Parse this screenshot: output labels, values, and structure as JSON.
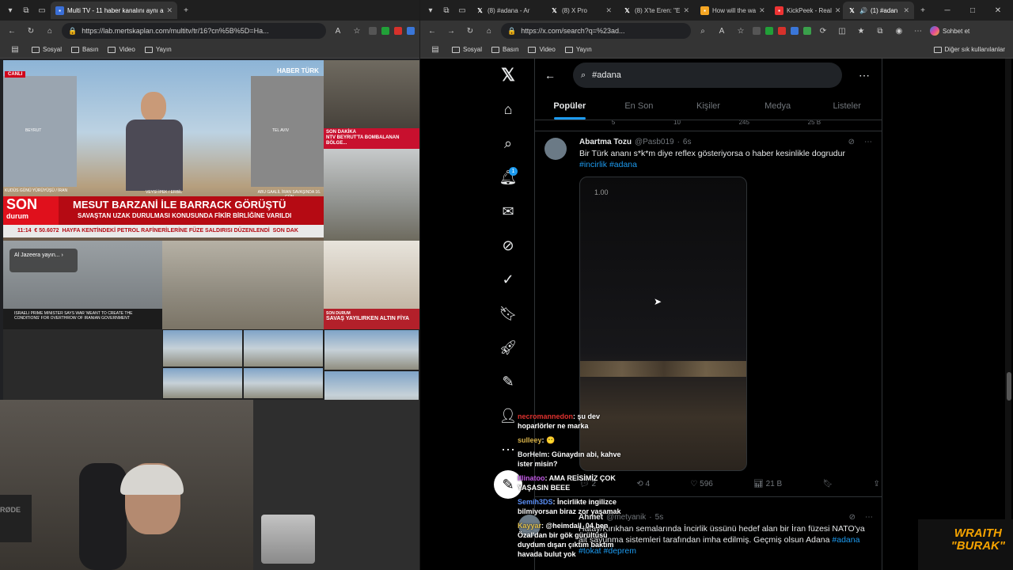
{
  "left_window": {
    "tabs": [
      {
        "title": "Multi TV - 11 haber kanalını aynı a",
        "active": true
      }
    ],
    "url": "https://lab.mertskaplan.com/multitv/tr/16?cn%5B%5D=Ha...",
    "bookmarks": [
      "Sosyal",
      "Basın",
      "Video",
      "Yayın"
    ],
    "multitv": {
      "main_logo": "HABER TÜRK",
      "live_label": "CANLI",
      "captions": {
        "beyrut": "BEYRUT",
        "tel_aviv": "TEL AVIV",
        "kudus": "KUDÜS GÜNÜ YÜRÜYÜŞÜ / İRAN",
        "erbil": "VEYSİ İPEK / ERBİL",
        "abu_gaalil": "ABU GAALİL İRAN SAVAŞINDA 16. GÜN"
      },
      "son_durum": {
        "brand": "SON",
        "brand_sub": "durum",
        "headline": "MESUT BARZANİ İLE BARRACK GÖRÜŞTÜ",
        "subline": "SAVAŞTAN UZAK DURULMASI KONUSUNDA FİKİR BİRLİĞİNE VARILDI",
        "ticker": "HAYFA KENTİNDEKİ PETROL RAFİNERİLERİNE FÜZE SALDIRISI DÜZENLENDİ",
        "time": "11:14",
        "rate": "€ 50.6072",
        "tag": "SON DAK"
      },
      "ntv_bar": "NTV BEYRUT'TA BOMBALANAN BÖLGE...",
      "ntv_sub": "SON DAKİKA",
      "al_jazeera_pill": "Al Jazeera yayın...",
      "aj_ticker": "ISRAELI PRIME MINISTER SAYS WAR 'MEANT TO CREATE THE CONDITIONS' FOR OVERTHROW OF IRANIAN GOVERNMENT",
      "studio_bar": "SAVAŞ YAYILIRKEN ALTIN FİYA",
      "studio_sub": "SON DURUM",
      "mic_brand": "RØDE"
    }
  },
  "right_window": {
    "tabs": [
      {
        "title": "(8) #adana - Ar",
        "active": false
      },
      {
        "title": "(8) X Pro",
        "active": false
      },
      {
        "title": "(8) X'te Eren: \"E",
        "active": false
      },
      {
        "title": "How will the wa",
        "active": false
      },
      {
        "title": "KickPeek - Real",
        "active": false
      },
      {
        "title": "(1) #adan",
        "active": true
      }
    ],
    "url": "https://x.com/search?q=%23ad...",
    "bookmarks": [
      "Sosyal",
      "Basın",
      "Video",
      "Yayın"
    ],
    "other_bookmarks": "Diğer sık kullanılanlar",
    "copilot_label": "Sohbet et"
  },
  "x": {
    "search_value": "#adana",
    "tabs": [
      "Popüler",
      "En Son",
      "Kişiler",
      "Medya",
      "Listeler"
    ],
    "notification_count": "1",
    "prev_tweet_actions": {
      "replies": "5",
      "reposts": "10",
      "likes": "245",
      "views": "25 B"
    },
    "tweet": {
      "name": "Abartma Tozu",
      "handle": "@Pasb019",
      "time": "6s",
      "text": "Bir Türk  ananı s*k*m diye reflex gösteriyorsa o haber  kesinlikle dogrudur",
      "tags": [
        "#incirlik",
        "#adana"
      ],
      "media_rate": "1.00",
      "replies": "2",
      "reposts": "4",
      "likes": "596",
      "views": "21 B"
    },
    "tweet2": {
      "name": "Ahmet",
      "handle": "@metyanik",
      "time": "5s",
      "text": "Hatay/Kırıkhan semalarında İncirlik üssünü hedef alan bir İran füzesi NATO'ya ait savunma sistemleri tarafından imha edilmiş. Geçmiş olsun Adana",
      "tags": [
        "#adana",
        "#tokat",
        "#deprem"
      ]
    }
  },
  "stream_chat": [
    {
      "user": "necromannedon",
      "message": "şu dev hoparlörler ne marka",
      "color": "#e0322f"
    },
    {
      "user": "sulleey",
      "message": "😶",
      "color": "#d8b34a"
    },
    {
      "user": "BorHelm",
      "message": "Günaydın abi, kahve ister misin?",
      "color": "#e7e9ea"
    },
    {
      "user": "Illinatoo",
      "message": "AMA REİSİMİZ ÇOK YAŞASIN BEEE",
      "color": "#c25ae5"
    },
    {
      "user": "Semih3DS",
      "message": "İncirlikte ingilizce bilmiyorsan biraz zor yaşamak",
      "color": "#5a8ef5"
    },
    {
      "user": "Kayyar",
      "message": "@heimdall_04 ben Özal'dan bir gök gürültüsü duydum dışarı çıktım baktım havada bulut yok",
      "color": "#e0c050"
    }
  ],
  "watermark": {
    "line1": "WRAITH",
    "line2": "\"BURAK\""
  },
  "colors": {
    "x_blue": "#1d9bf0",
    "son_red": "#b50a13",
    "accent_orange": "#f5a300"
  }
}
